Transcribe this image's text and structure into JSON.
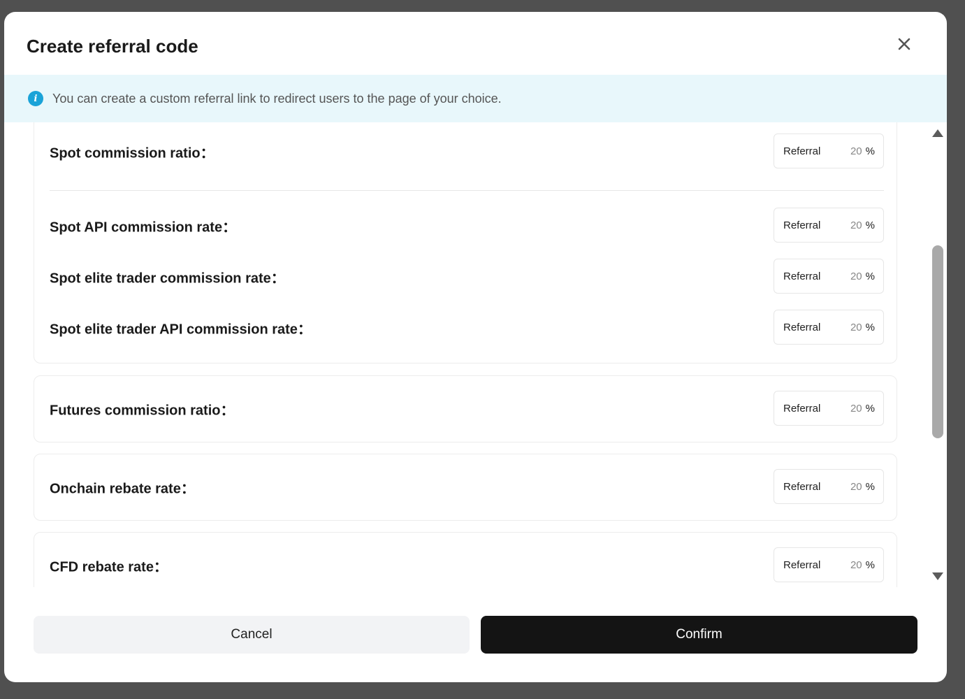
{
  "modal": {
    "title": "Create referral code",
    "close_icon": "close-icon"
  },
  "notice": {
    "icon": "info-icon",
    "icon_glyph": "i",
    "text": "You can create a custom referral link to redirect users to the page of your choice."
  },
  "rates": [
    {
      "label": "Spot commission ratio：",
      "field_label": "Referral",
      "value": "20",
      "unit": "%"
    },
    {
      "label": "Spot API commission rate：",
      "field_label": "Referral",
      "value": "20",
      "unit": "%"
    },
    {
      "label": "Spot elite trader commission rate：",
      "field_label": "Referral",
      "value": "20",
      "unit": "%"
    },
    {
      "label": "Spot elite trader API commission rate：",
      "field_label": "Referral",
      "value": "20",
      "unit": "%"
    },
    {
      "label": "Futures commission ratio：",
      "field_label": "Referral",
      "value": "20",
      "unit": "%"
    },
    {
      "label": "Onchain rebate rate：",
      "field_label": "Referral",
      "value": "20",
      "unit": "%"
    },
    {
      "label": "CFD rebate rate：",
      "field_label": "Referral",
      "value": "20",
      "unit": "%"
    }
  ],
  "actions": {
    "cancel_label": "Cancel",
    "confirm_label": "Confirm"
  },
  "colors": {
    "notice_bg": "#e8f7fb",
    "info_icon": "#1aa3d8",
    "confirm_bg": "#141414",
    "cancel_bg": "#f2f3f5"
  }
}
